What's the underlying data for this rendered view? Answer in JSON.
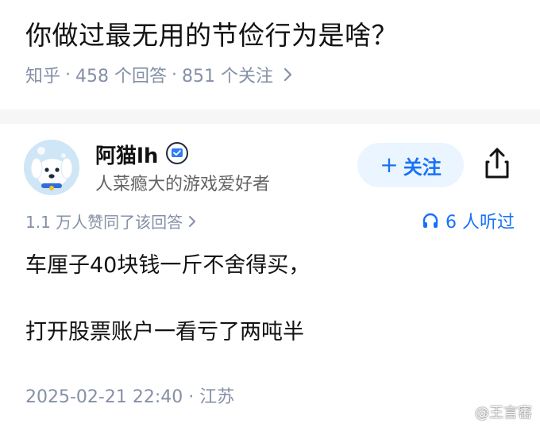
{
  "question": {
    "title": "你做过最无用的节俭行为是啥？",
    "source": "知乎",
    "answers_count": "458 个回答",
    "followers_count": "851 个关注",
    "sep": "·"
  },
  "author": {
    "name": "阿猫lh",
    "bio": "人菜瘾大的游戏爱好者",
    "avatar_icon": "dog-avatar-icon",
    "badge_icon": "verified-badge-icon"
  },
  "actions": {
    "follow_plus": "+",
    "follow_label": "关注",
    "share_icon": "share-icon"
  },
  "answer": {
    "upvotes_text": "1.1 万人赞同了该回答",
    "listen_text": "6 人听过",
    "paragraphs": [
      "车厘子40块钱一斤不舍得买，",
      "打开股票账户一看亏了两吨半"
    ],
    "datetime": "2025-02-21 22:40",
    "location": "江苏",
    "sep": "·"
  },
  "watermark": {
    "text": "@王言窑"
  },
  "colors": {
    "accent": "#1772f6",
    "meta_gray": "#8590a6",
    "follow_bg": "#ebf5ff"
  }
}
